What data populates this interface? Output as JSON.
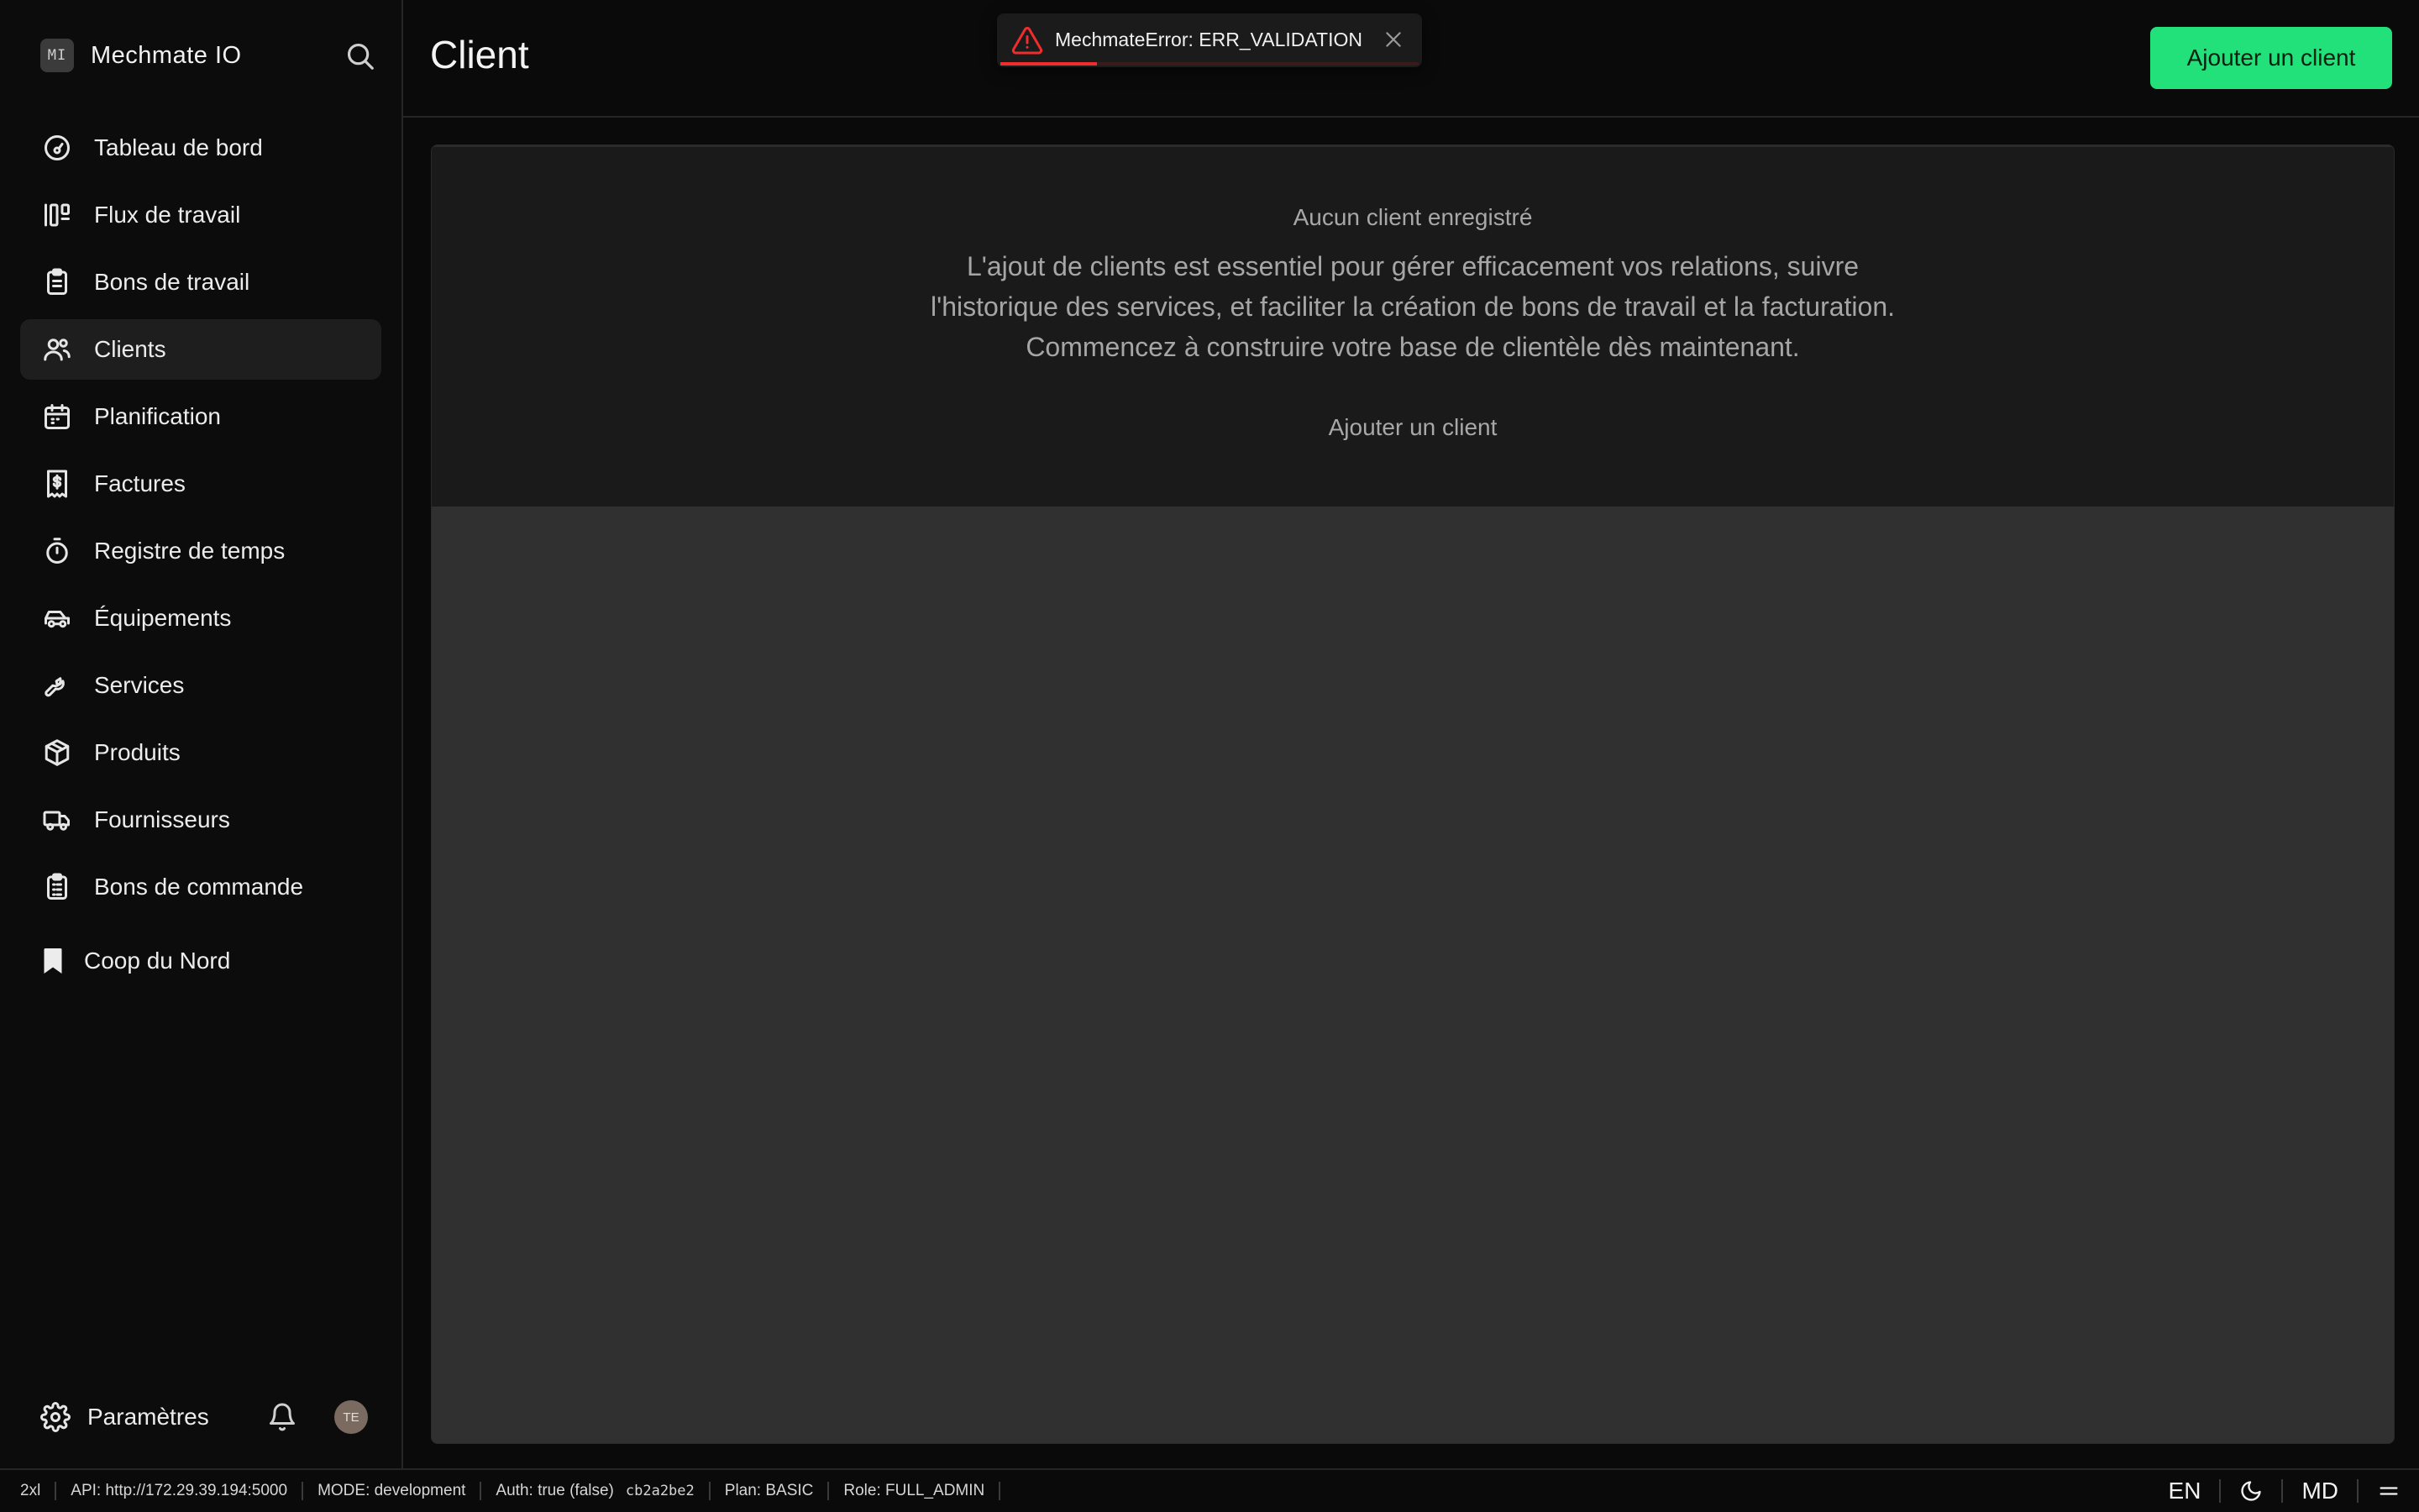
{
  "app": {
    "logo_initials": "MI",
    "name": "Mechmate IO"
  },
  "sidebar": {
    "items": [
      {
        "label": "Tableau de bord",
        "icon": "dashboard-gauge-icon"
      },
      {
        "label": "Flux de travail",
        "icon": "workflow-kanban-icon"
      },
      {
        "label": "Bons de travail",
        "icon": "clipboard-icon"
      },
      {
        "label": "Clients",
        "icon": "users-icon",
        "active": true
      },
      {
        "label": "Planification",
        "icon": "calendar-icon"
      },
      {
        "label": "Factures",
        "icon": "invoice-dollar-icon"
      },
      {
        "label": "Registre de temps",
        "icon": "stopwatch-icon"
      },
      {
        "label": "Équipements",
        "icon": "car-icon"
      },
      {
        "label": "Services",
        "icon": "wrench-icon"
      },
      {
        "label": "Produits",
        "icon": "package-box-icon"
      },
      {
        "label": "Fournisseurs",
        "icon": "truck-icon"
      },
      {
        "label": "Bons de commande",
        "icon": "clipboard-list-icon"
      }
    ],
    "organization": "Coop du Nord",
    "settings_label": "Paramètres",
    "avatar_initials": "TE"
  },
  "header": {
    "title": "Client",
    "primary_action": "Ajouter un client"
  },
  "toast": {
    "message": "MechmateError: ERR_VALIDATION",
    "progress_fraction": 0.23
  },
  "empty_state": {
    "title": "Aucun client enregistré",
    "description": "L'ajout de clients est essentiel pour gérer efficacement vos relations, suivre l'historique des services, et faciliter la création de bons de travail et la facturation. Commencez à construire votre base de clientèle dès maintenant.",
    "action": "Ajouter un client"
  },
  "statusbar": {
    "breakpoint": "2xl",
    "api": "API: http://172.29.39.194:5000",
    "mode": "MODE: development",
    "auth": "Auth: true (false)",
    "hash": "cb2a2be2",
    "plan": "Plan: BASIC",
    "role": "Role: FULL_ADMIN",
    "language": "EN",
    "size": "MD"
  },
  "colors": {
    "accent": "#22e07a",
    "error": "#ef2d2d",
    "background": "#0a0a0a",
    "card": "#1a1a1a"
  }
}
